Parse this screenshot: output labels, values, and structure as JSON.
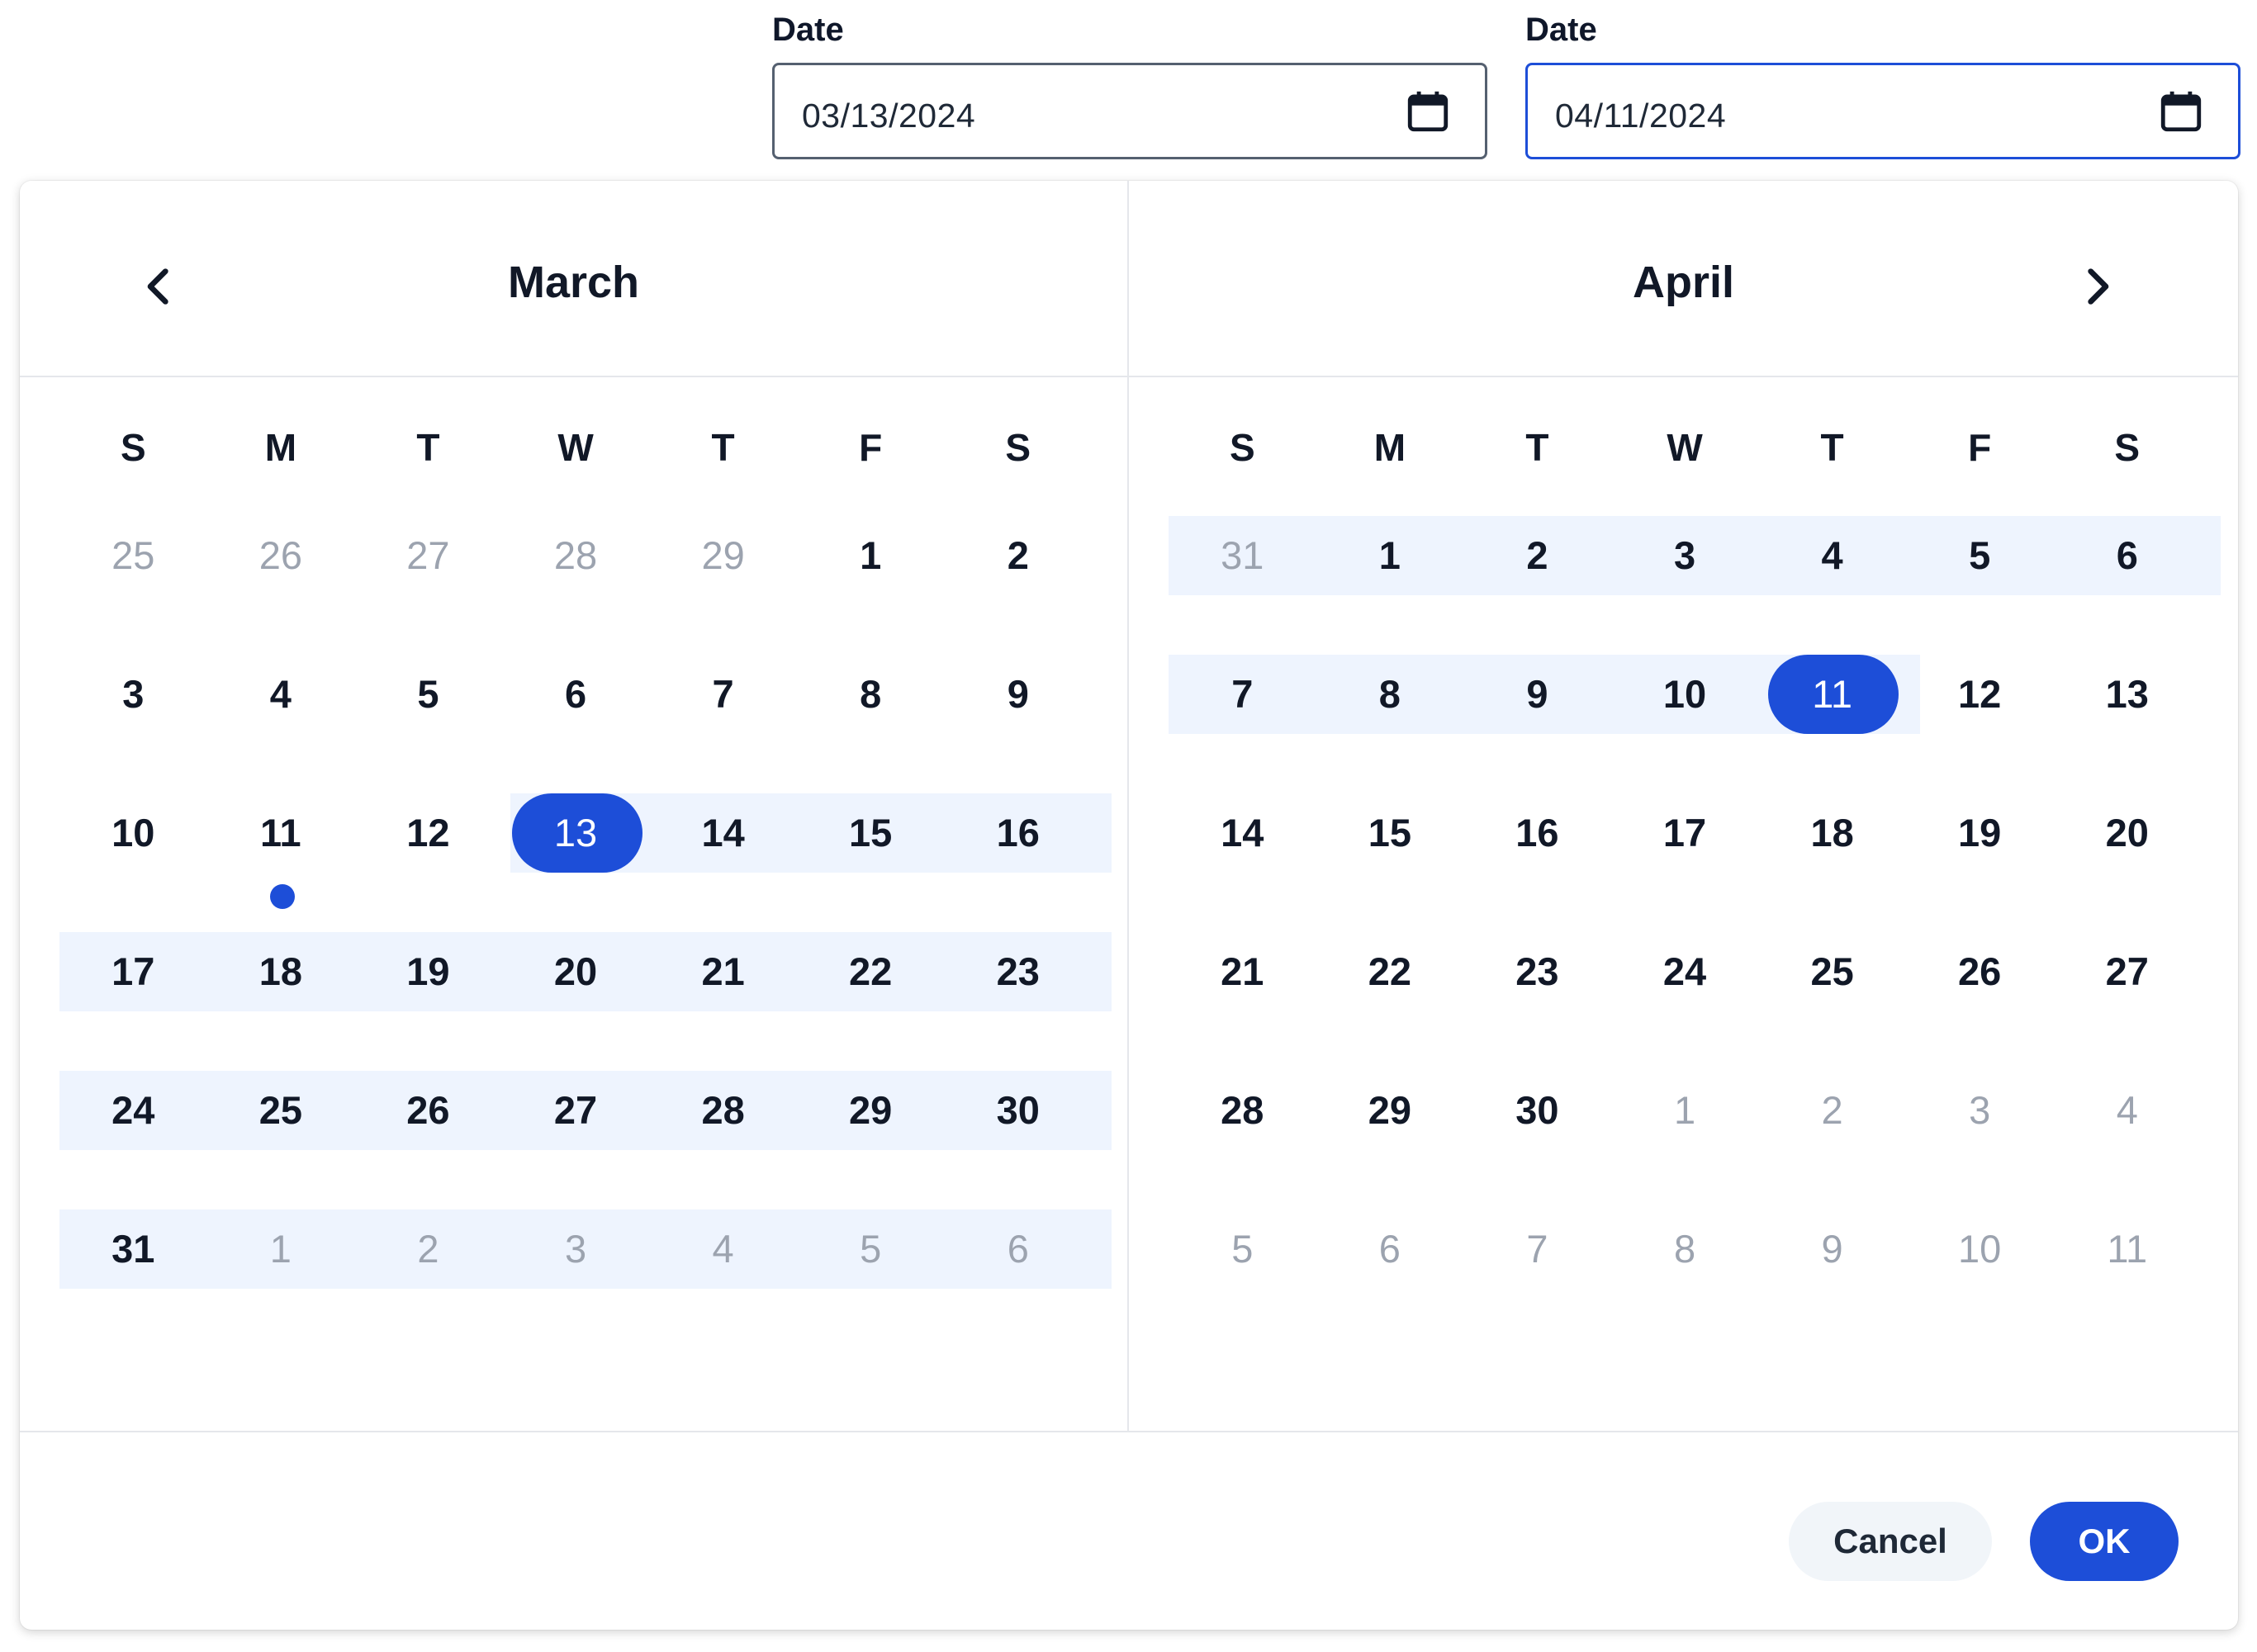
{
  "start_field": {
    "label": "Date",
    "value": "03/13/2024",
    "icon": "calendar-icon"
  },
  "end_field": {
    "label": "Date",
    "value": "04/11/2024",
    "icon": "calendar-icon"
  },
  "weekday_labels": [
    "S",
    "M",
    "T",
    "W",
    "T",
    "F",
    "S"
  ],
  "left_month": {
    "title": "March",
    "weeks": [
      [
        {
          "d": "25",
          "o": true
        },
        {
          "d": "26",
          "o": true
        },
        {
          "d": "27",
          "o": true
        },
        {
          "d": "28",
          "o": true
        },
        {
          "d": "29",
          "o": true
        },
        {
          "d": "1"
        },
        {
          "d": "2"
        }
      ],
      [
        {
          "d": "3"
        },
        {
          "d": "4"
        },
        {
          "d": "5"
        },
        {
          "d": "6"
        },
        {
          "d": "7"
        },
        {
          "d": "8"
        },
        {
          "d": "9"
        }
      ],
      [
        {
          "d": "10"
        },
        {
          "d": "11",
          "today": true
        },
        {
          "d": "12"
        },
        {
          "d": "13",
          "sel": true
        },
        {
          "d": "14"
        },
        {
          "d": "15"
        },
        {
          "d": "16"
        }
      ],
      [
        {
          "d": "17"
        },
        {
          "d": "18"
        },
        {
          "d": "19"
        },
        {
          "d": "20"
        },
        {
          "d": "21"
        },
        {
          "d": "22"
        },
        {
          "d": "23"
        }
      ],
      [
        {
          "d": "24"
        },
        {
          "d": "25"
        },
        {
          "d": "26"
        },
        {
          "d": "27"
        },
        {
          "d": "28"
        },
        {
          "d": "29"
        },
        {
          "d": "30"
        }
      ],
      [
        {
          "d": "31"
        },
        {
          "d": "1",
          "o": true
        },
        {
          "d": "2",
          "o": true
        },
        {
          "d": "3",
          "o": true
        },
        {
          "d": "4",
          "o": true
        },
        {
          "d": "5",
          "o": true
        },
        {
          "d": "6",
          "o": true
        }
      ]
    ],
    "range_rows": [
      null,
      null,
      [
        3,
        6
      ],
      [
        0,
        6
      ],
      [
        0,
        6
      ],
      [
        0,
        6
      ]
    ]
  },
  "right_month": {
    "title": "April",
    "weeks": [
      [
        {
          "d": "31",
          "o": true
        },
        {
          "d": "1"
        },
        {
          "d": "2"
        },
        {
          "d": "3"
        },
        {
          "d": "4"
        },
        {
          "d": "5"
        },
        {
          "d": "6"
        }
      ],
      [
        {
          "d": "7"
        },
        {
          "d": "8"
        },
        {
          "d": "9"
        },
        {
          "d": "10"
        },
        {
          "d": "11",
          "sel": true
        },
        {
          "d": "12"
        },
        {
          "d": "13"
        }
      ],
      [
        {
          "d": "14"
        },
        {
          "d": "15"
        },
        {
          "d": "16"
        },
        {
          "d": "17"
        },
        {
          "d": "18"
        },
        {
          "d": "19"
        },
        {
          "d": "20"
        }
      ],
      [
        {
          "d": "21"
        },
        {
          "d": "22"
        },
        {
          "d": "23"
        },
        {
          "d": "24"
        },
        {
          "d": "25"
        },
        {
          "d": "26"
        },
        {
          "d": "27"
        }
      ],
      [
        {
          "d": "28"
        },
        {
          "d": "29"
        },
        {
          "d": "30"
        },
        {
          "d": "1",
          "o": true
        },
        {
          "d": "2",
          "o": true
        },
        {
          "d": "3",
          "o": true
        },
        {
          "d": "4",
          "o": true
        }
      ],
      [
        {
          "d": "5",
          "o": true
        },
        {
          "d": "6",
          "o": true
        },
        {
          "d": "7",
          "o": true
        },
        {
          "d": "8",
          "o": true
        },
        {
          "d": "9",
          "o": true
        },
        {
          "d": "10",
          "o": true
        },
        {
          "d": "11",
          "o": true
        }
      ]
    ],
    "range_rows": [
      [
        0,
        6
      ],
      [
        0,
        4
      ],
      null,
      null,
      null,
      null
    ]
  },
  "nav": {
    "prev_icon": "chevron-left-icon",
    "next_icon": "chevron-right-icon"
  },
  "footer": {
    "cancel_label": "Cancel",
    "ok_label": "OK"
  },
  "colors": {
    "accent": "#1d4ed8",
    "range_fill": "#eef4fe",
    "muted_text": "#9ca3af"
  }
}
